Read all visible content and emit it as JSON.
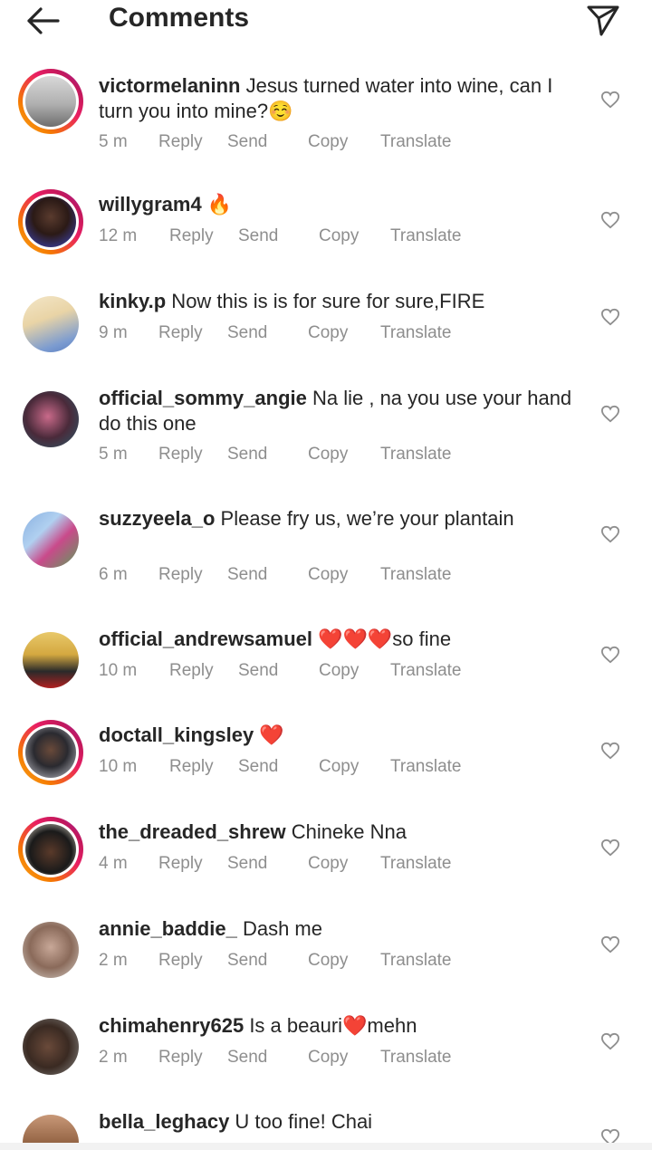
{
  "header": {
    "title": "Comments",
    "back_icon": "arrow-left-icon",
    "share_icon": "paper-plane-icon"
  },
  "actions": {
    "reply": "Reply",
    "send": "Send",
    "copy": "Copy",
    "translate": "Translate"
  },
  "comments": [
    {
      "username": "victormelaninn",
      "text": " Jesus turned water into wine, can I turn you into mine?☺️",
      "time": "5 m",
      "ring": true
    },
    {
      "username": "willygram4",
      "text": " 🔥",
      "time": "12 m",
      "ring": true
    },
    {
      "username": "kinky.p",
      "text": " Now this is is for sure for sure,FIRE",
      "time": "9 m",
      "ring": false
    },
    {
      "username": "official_sommy_angie",
      "text": " Na lie , na you use your hand do this one",
      "time": "5 m",
      "ring": false
    },
    {
      "username": "suzzyeela_o",
      "text": " Please fry us, we’re your plantain",
      "time": "6 m",
      "ring": false
    },
    {
      "username": "official_andrewsamuel",
      "text": " ❤️❤️❤️so fine",
      "time": "10 m",
      "ring": false
    },
    {
      "username": "doctall_kingsley",
      "text": " ❤️",
      "time": "10 m",
      "ring": true
    },
    {
      "username": "the_dreaded_shrew",
      "text": " Chineke Nna",
      "time": "4 m",
      "ring": true
    },
    {
      "username": "annie_baddie_",
      "text": " Dash me",
      "time": "2 m",
      "ring": false
    },
    {
      "username": "chimahenry625",
      "text": " Is a beauri❤️mehn",
      "time": "2 m",
      "ring": false
    },
    {
      "username": "bella_leghacy",
      "text": " U too fine! Chai",
      "time": "",
      "ring": false
    }
  ]
}
